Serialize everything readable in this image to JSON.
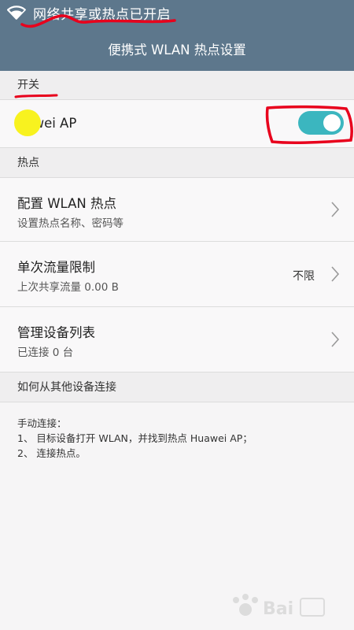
{
  "status_bar": {
    "notification": "网络共享或热点已开启",
    "icon": "wifi-icon"
  },
  "header": {
    "title": "便携式 WLAN 热点设置"
  },
  "switch_section": {
    "label": "开关",
    "ap_name": "uawei AP",
    "toggle_on": true,
    "toggle_color": "#3bb6bf"
  },
  "hotspot_section": {
    "label": "热点",
    "items": [
      {
        "title": "配置 WLAN 热点",
        "subtitle": "设置热点名称、密码等",
        "value": "",
        "icon": "chevron-right-icon"
      },
      {
        "title": "单次流量限制",
        "subtitle": "上次共享流量 0.00 B",
        "value": "不限",
        "icon": "chevron-right-icon"
      },
      {
        "title": "管理设备列表",
        "subtitle": "已连接 0 台",
        "value": "",
        "icon": "chevron-right-icon"
      }
    ]
  },
  "connect_section": {
    "label": "如何从其他设备连接",
    "lines": [
      "手动连接：",
      "1、 目标设备打开 WLAN，并找到热点 Huawei AP；",
      "2、 连接热点。"
    ]
  },
  "theme": {
    "bar_color": "#5d778c",
    "annotation_color": "#e8001c"
  }
}
